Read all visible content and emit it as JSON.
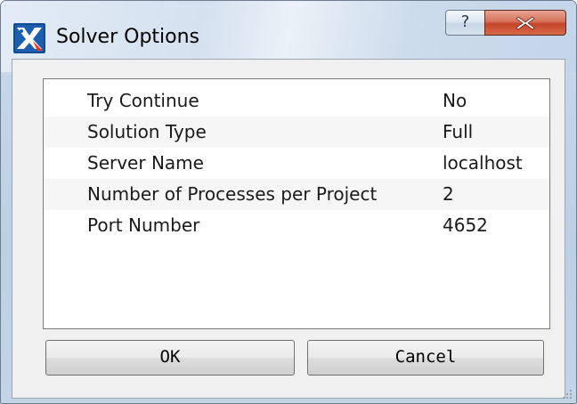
{
  "window": {
    "title": "Solver Options",
    "help_label": "?",
    "icons": {
      "app": "solver-app-icon",
      "help": "help-icon",
      "close": "close-icon",
      "grip": "resize-grip-icon"
    }
  },
  "options": [
    {
      "name": "Try Continue",
      "value": "No"
    },
    {
      "name": "Solution Type",
      "value": "Full"
    },
    {
      "name": "Server Name",
      "value": "localhost"
    },
    {
      "name": "Number of Processes per Project",
      "value": "2"
    },
    {
      "name": "Port Number",
      "value": "4652"
    }
  ],
  "buttons": {
    "ok_label": "OK",
    "cancel_label": "Cancel"
  },
  "colors": {
    "close_button": "#c5452b",
    "title_bar": "#d4e1ef"
  }
}
